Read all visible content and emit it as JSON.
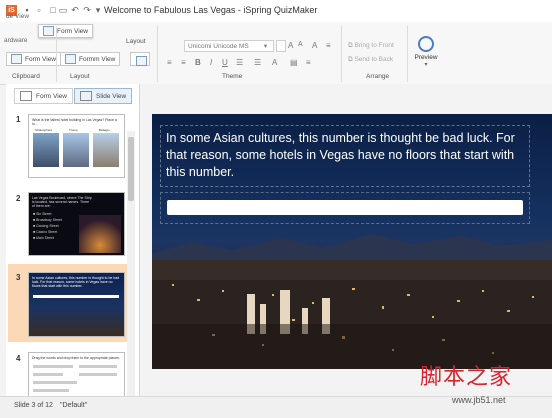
{
  "window": {
    "title": "Welcome to Fabulous Las Vegas - iSpring QuizMaker",
    "app_icon_letter": "iS"
  },
  "ribbon": {
    "tabs_ghost": [
      "de View",
      "ardware"
    ],
    "popup_form_view_label": "Form View",
    "groups": {
      "clipboard": "Clipboard",
      "layout": "Layout",
      "theme": "Theme",
      "arrange": "Arrange"
    },
    "form_view_button": "Form View",
    "form_view_button_alt": "Formm View",
    "font_name": "Unicomi Unicode MS",
    "bring_to_front": "Bring to Front",
    "send_to_back": "Send to Back",
    "preview_label": "Preview",
    "layout_label": "Layout"
  },
  "left_pane": {
    "tabs": [
      {
        "label": "Form View"
      },
      {
        "label": "Slide View"
      }
    ],
    "thumbnails": [
      {
        "number": "1",
        "text": "What is the tallest hotel building in Las Vegas? Place a lo...",
        "captions": [
          "Stratosphere",
          "Trump",
          "Bellagio"
        ]
      },
      {
        "number": "2",
        "text": "Las Vegas Boulevard, where The Strip is located, has several names. Three of them are:",
        "items": [
          "Sin Street",
          "Broadway Street",
          "Gaming Street",
          "Casino Street",
          "Main Street"
        ]
      },
      {
        "number": "3",
        "text": "In some Asian cultures, this number is thought to be bad luck. For that reason, some hotels in Vegas have no floors that start with this number."
      },
      {
        "number": "4",
        "text": "Drag the words and drop them to the appropriate places:"
      }
    ]
  },
  "slide": {
    "question": "In some Asian cultures, this number is thought be bad luck. For that reason, some hotels in Vegas have no floors that start with this number.",
    "answer_value": ""
  },
  "status": {
    "slide_position": "Slide 3 of 12",
    "theme": "\"Default\""
  },
  "watermark": {
    "cn": "脚本之家",
    "url": "www.jb51.net"
  },
  "colors": {
    "accent": "#e06a2b",
    "selected_thumb_bg": "#fbd8b6",
    "slide_blue": "#14305e"
  }
}
